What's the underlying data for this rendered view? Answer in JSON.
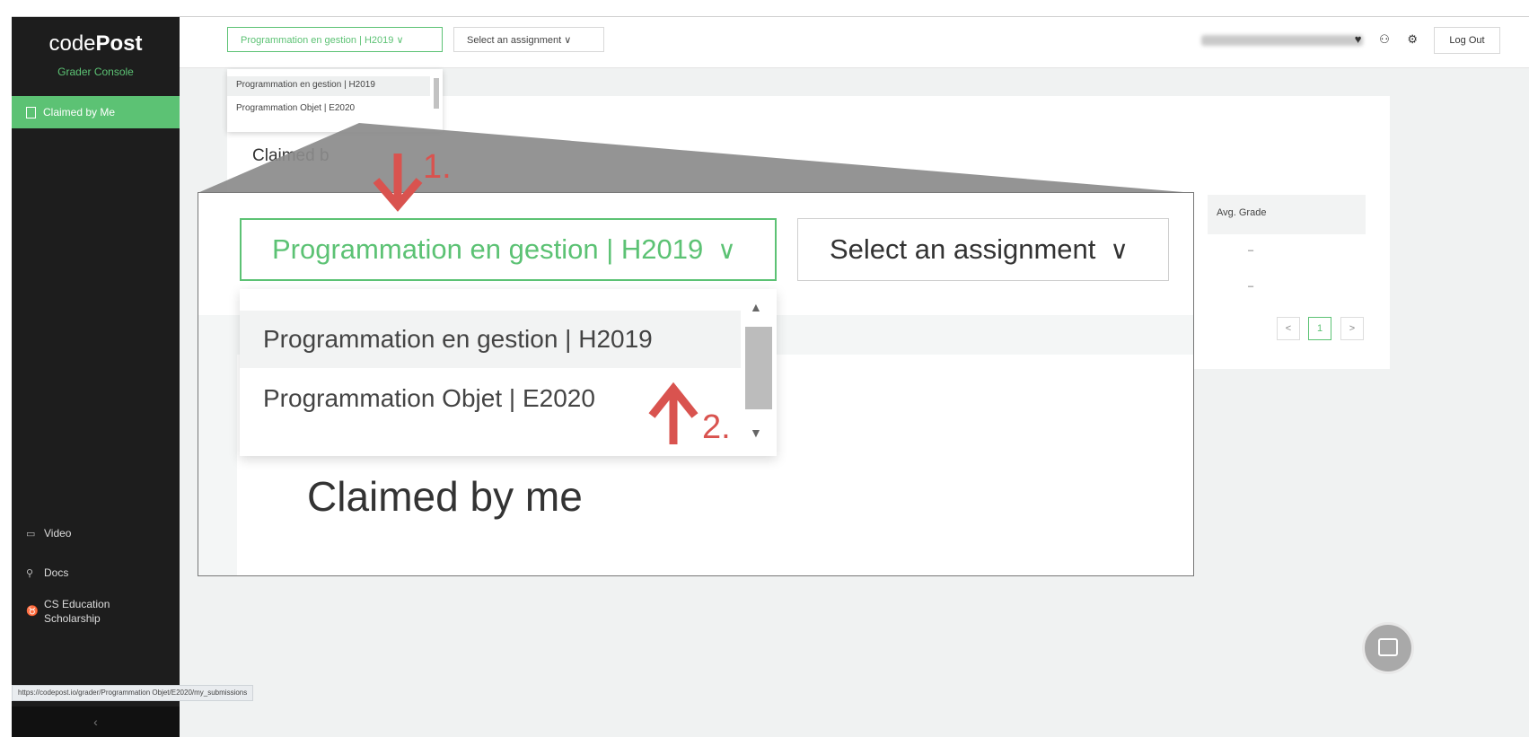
{
  "sidebar": {
    "logo_regular": "code",
    "logo_bold": "Post",
    "subtitle": "Grader Console",
    "active_item": "Claimed by Me",
    "links": [
      {
        "icon": "video-icon",
        "glyph": "▭",
        "label": "Video"
      },
      {
        "icon": "docs-icon",
        "glyph": "⚲",
        "label": "Docs"
      },
      {
        "icon": "trophy-icon",
        "glyph": "♉",
        "label": "CS Education Scholarship"
      }
    ],
    "collapse_glyph": "‹"
  },
  "topbar": {
    "course_select": "Programmation en gestion | H2019",
    "assignment_select": "Select an assignment",
    "icons": [
      "heart-icon",
      "user-icon",
      "gear-icon"
    ],
    "icon_glyphs": "♥ ⚇ ⚙",
    "logout": "Log Out"
  },
  "course_options": [
    "Programmation en gestion | H2019",
    "Programmation Objet | E2020"
  ],
  "card": {
    "title": "Claimed by me",
    "title_partial": "Claimed b",
    "avg_header": "Avg. Grade",
    "dashes": [
      "–",
      "–"
    ],
    "pager_prev": "<",
    "pager_page": "1",
    "pager_next": ">"
  },
  "zoom": {
    "course_select": "Programmation en gestion | H2019",
    "assignment_select": "Select an assignment",
    "chevron": "∨",
    "options": [
      "Programmation en gestion | H2019",
      "Programmation Objet | E2020"
    ],
    "title": "Claimed by me"
  },
  "annotations": {
    "step1": "1.",
    "step2": "2.",
    "arrow_color": "#d9534f"
  },
  "status_url": "https://codepost.io/grader/Programmation Objet/E2020/my_submissions",
  "colors": {
    "accent": "#5cc274",
    "sidebar": "#1d1d1d"
  }
}
